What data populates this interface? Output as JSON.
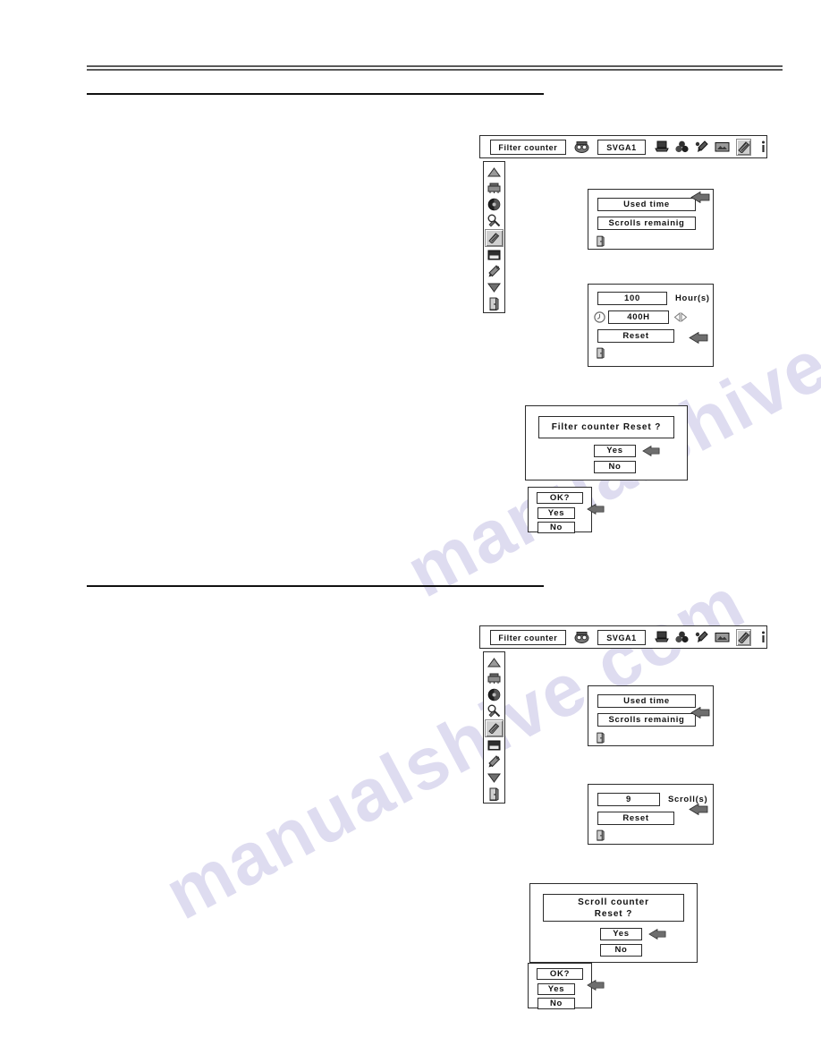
{
  "page": {
    "watermark": "manualshive.com"
  },
  "sections": [
    {
      "id": "filter-counter",
      "menubar": {
        "title": "Filter counter",
        "source": "SVGA1",
        "icons": [
          "projector-head-icon",
          "computer-icon",
          "color-balls-icon",
          "paint-brush-icon",
          "screen-image-icon",
          "setting-icon",
          "info-icon"
        ]
      },
      "sidebar_items": [
        "scroll-up-arrow-icon",
        "projector-icon",
        "contrast-circle-icon",
        "pointer-icon",
        "setting-icon",
        "screen-icon",
        "tool-icon",
        "scroll-down-arrow-icon",
        "exit-door-icon"
      ],
      "select_panel": {
        "options": [
          "Used time",
          "Scrolls remainig"
        ],
        "pointer_index": 0,
        "quit_icon": "exit-door-icon"
      },
      "value_panel": {
        "value": "100",
        "unit": "Hour(s)",
        "timer_icon": "clock-icon",
        "timer_value": "400H",
        "adjust_icon": "left-right-arrows-icon",
        "reset_label": "Reset",
        "pointer_target": "Reset",
        "quit_icon": "exit-door-icon"
      },
      "confirm_dialog": {
        "message_lines": [
          "Filter counter Reset  ?"
        ],
        "yes_label": "Yes",
        "no_label": "No",
        "pointer_target": "Yes"
      },
      "ok_dialog": {
        "title": "OK?",
        "yes_label": "Yes",
        "no_label": "No",
        "pointer_target": "Yes"
      }
    },
    {
      "id": "scroll-counter",
      "menubar": {
        "title": "Filter counter",
        "source": "SVGA1",
        "icons": [
          "projector-head-icon",
          "computer-icon",
          "color-balls-icon",
          "paint-brush-icon",
          "screen-image-icon",
          "setting-icon",
          "info-icon"
        ]
      },
      "sidebar_items": [
        "scroll-up-arrow-icon",
        "projector-icon",
        "contrast-circle-icon",
        "pointer-icon",
        "setting-icon",
        "screen-icon",
        "tool-icon",
        "scroll-down-arrow-icon",
        "exit-door-icon"
      ],
      "select_panel": {
        "options": [
          "Used time",
          "Scrolls remainig"
        ],
        "pointer_index": 1,
        "quit_icon": "exit-door-icon"
      },
      "value_panel": {
        "value": "9",
        "unit": "Scroll(s)",
        "reset_label": "Reset",
        "pointer_target": "Reset",
        "quit_icon": "exit-door-icon"
      },
      "confirm_dialog": {
        "message_lines": [
          "Scroll counter",
          "Reset  ?"
        ],
        "yes_label": "Yes",
        "no_label": "No",
        "pointer_target": "Yes"
      },
      "ok_dialog": {
        "title": "OK?",
        "yes_label": "Yes",
        "no_label": "No",
        "pointer_target": "Yes"
      }
    }
  ]
}
